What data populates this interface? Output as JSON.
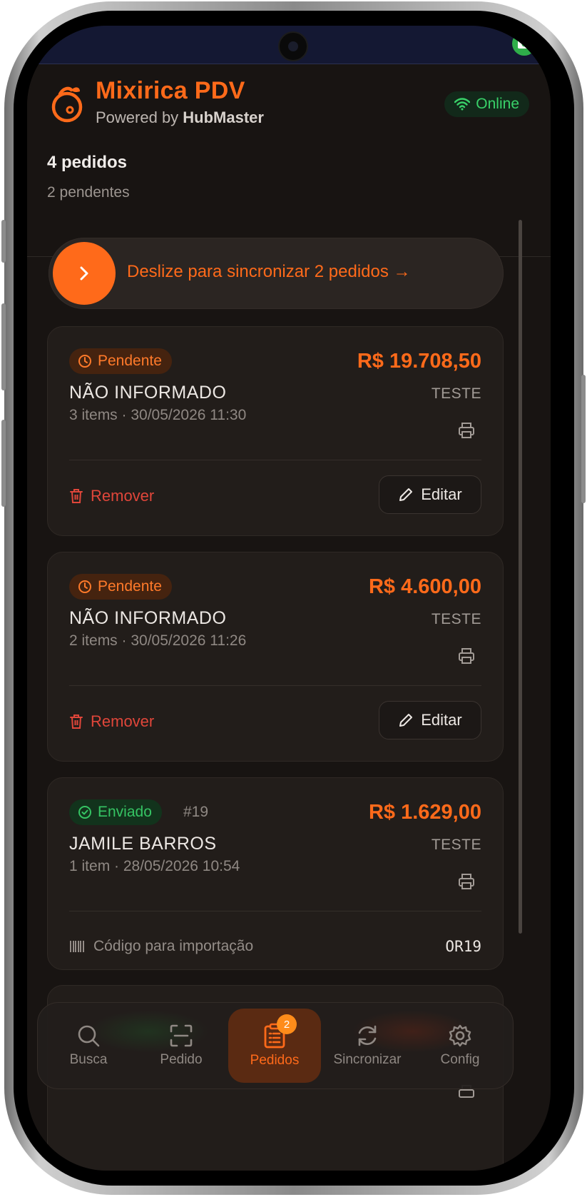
{
  "app": {
    "title": "Mixirica PDV",
    "powered_prefix": "Powered by ",
    "powered_brand": "HubMaster",
    "status": "Online"
  },
  "summary": {
    "orders": "4 pedidos",
    "pending": "2 pendentes"
  },
  "sync_slider": {
    "label": "Deslize para sincronizar 2 pedidos →"
  },
  "orders": [
    {
      "status": "Pendente",
      "status_icon": "clock-icon",
      "number": "",
      "amount": "R$ 19.708,50",
      "customer": "NÃO INFORMADO",
      "meta": "3 items · 30/05/2026 11:30",
      "seller": "TESTE",
      "remove_label": "Remover",
      "edit_label": "Editar"
    },
    {
      "status": "Pendente",
      "status_icon": "clock-icon",
      "number": "",
      "amount": "R$ 4.600,00",
      "customer": "NÃO INFORMADO",
      "meta": "2 items · 30/05/2026 11:26",
      "seller": "TESTE",
      "remove_label": "Remover",
      "edit_label": "Editar"
    },
    {
      "status": "Enviado",
      "status_icon": "check-circle-icon",
      "number": "#19",
      "amount": "R$ 1.629,00",
      "customer": "JAMILE BARROS",
      "meta": "1 item · 28/05/2026 10:54",
      "seller": "TESTE",
      "import_label": "Código para importação",
      "import_code": "OR19"
    }
  ],
  "nav": {
    "items": [
      {
        "label": "Busca",
        "icon": "search-icon"
      },
      {
        "label": "Pedido",
        "icon": "scan-icon"
      },
      {
        "label": "Pedidos",
        "icon": "clipboard-list-icon",
        "badge": "2",
        "active": true
      },
      {
        "label": "Sincronizar",
        "icon": "refresh-icon"
      },
      {
        "label": "Config",
        "icon": "gear-icon"
      }
    ]
  },
  "colors": {
    "accent": "#ff6a1a",
    "background": "#181412",
    "card": "#221d1a",
    "online": "#39d169",
    "danger": "#e0463a"
  }
}
